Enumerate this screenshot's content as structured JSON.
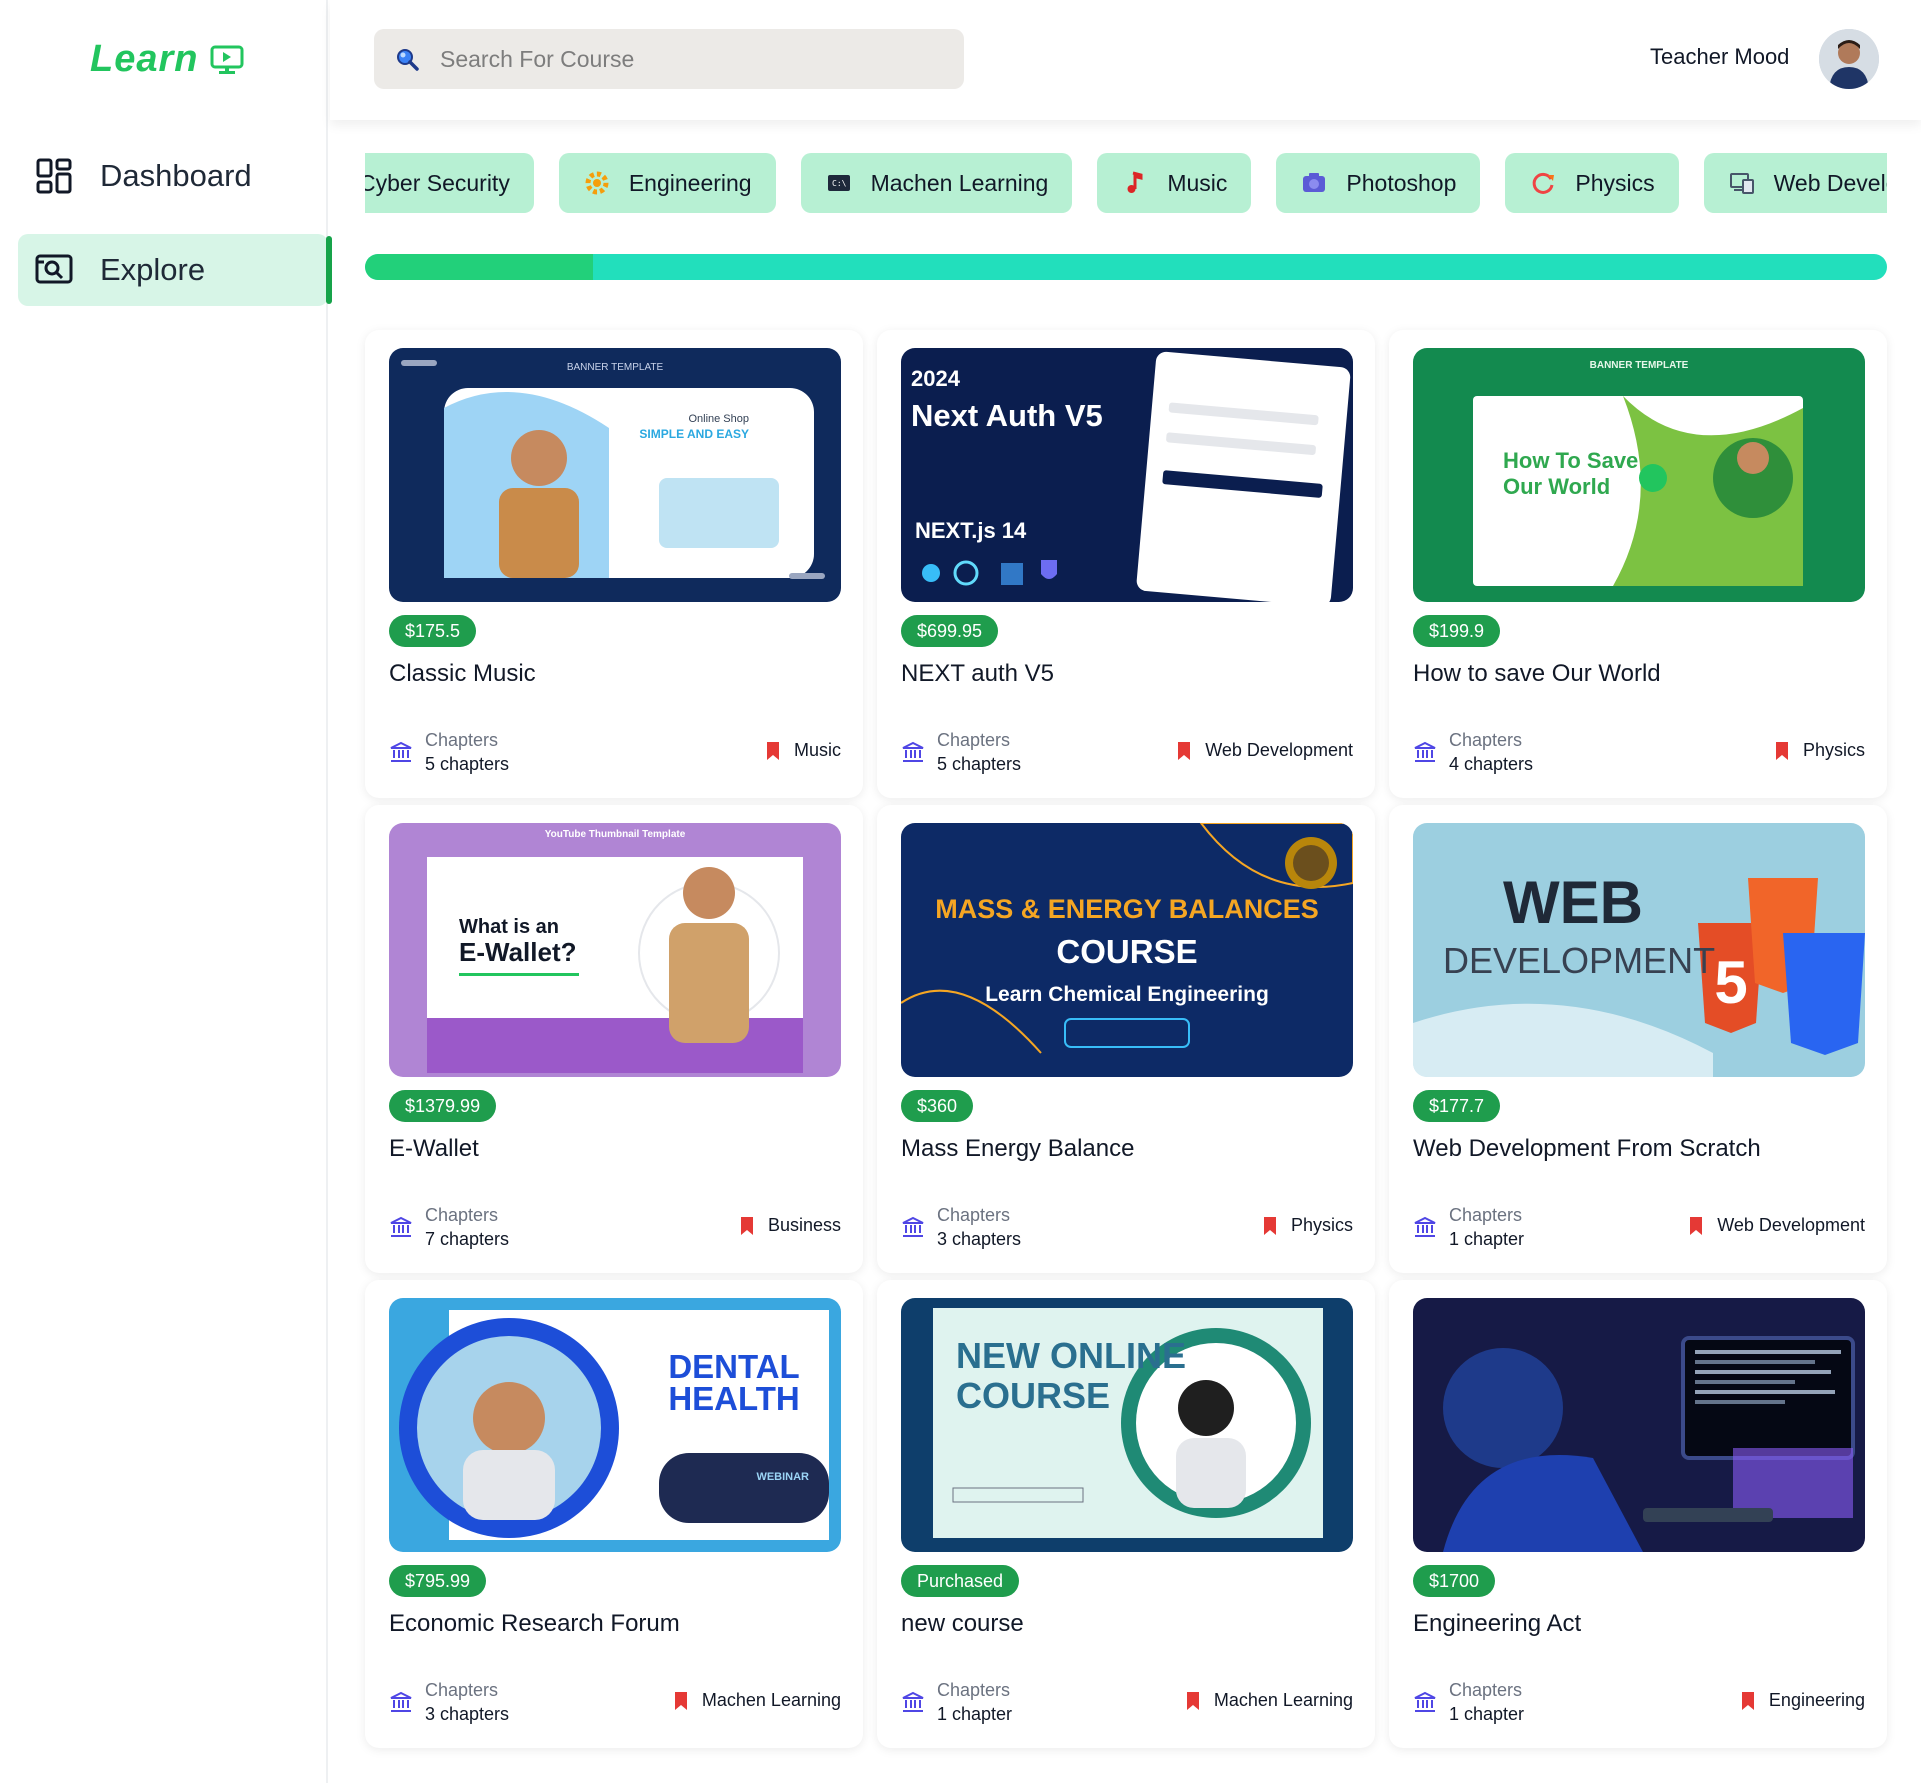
{
  "app": {
    "logo_text": "Learn"
  },
  "sidebar": {
    "items": [
      {
        "label": "Dashboard",
        "icon": "dashboard-icon",
        "active": false
      },
      {
        "label": "Explore",
        "icon": "explore-icon",
        "active": true
      }
    ]
  },
  "header": {
    "search_placeholder": "Search For Course",
    "user_name": "Teacher Mood"
  },
  "categories": [
    {
      "label": "Cyber Security",
      "icon": "none"
    },
    {
      "label": "Engineering",
      "icon": "gear-icon"
    },
    {
      "label": "Machen Learning",
      "icon": "terminal-icon"
    },
    {
      "label": "Music",
      "icon": "music-note-icon"
    },
    {
      "label": "Photoshop",
      "icon": "camera-icon"
    },
    {
      "label": "Physics",
      "icon": "refresh-icon"
    },
    {
      "label": "Web Development",
      "icon": "devices-icon"
    }
  ],
  "scroll_position": 0.15,
  "chapters_label": "Chapters",
  "courses": [
    {
      "price": "$175.5",
      "title": "Classic Music",
      "chapters": "5 chapters",
      "category": "Music",
      "thumb": {
        "bg": "#0f2a5c",
        "accent": "#9ed4f5",
        "l1": "BANNER TEMPLATE",
        "l2": "Online Shop",
        "l3": "SIMPLE AND EASY"
      }
    },
    {
      "price": "$699.95",
      "title": "NEXT auth V5",
      "chapters": "5 chapters",
      "category": "Web Development",
      "thumb": {
        "bg": "#0b1e4f",
        "accent": "#ffffff",
        "l1": "2024",
        "l2": "Next Auth V5",
        "l3": "NEXT.js 14"
      }
    },
    {
      "price": "$199.9",
      "title": "How to save Our World",
      "chapters": "4 chapters",
      "category": "Physics",
      "thumb": {
        "bg": "#138a4f",
        "accent": "#ffffff",
        "l1": "BANNER TEMPLATE",
        "l2": "How To Save",
        "l3": "Our World"
      }
    },
    {
      "price": "$1379.99",
      "title": "E-Wallet",
      "chapters": "7 chapters",
      "category": "Business",
      "thumb": {
        "bg": "#b085d4",
        "accent": "#ffffff",
        "l1": "YouTube Thumbnail Template",
        "l2": "What is an",
        "l3": "E-Wallet?"
      }
    },
    {
      "price": "$360",
      "title": "Mass Energy Balance",
      "chapters": "3 chapters",
      "category": "Physics",
      "thumb": {
        "bg": "#0d2a66",
        "accent": "#f5a623",
        "l1": "MASS & ENERGY BALANCES",
        "l2": "COURSE",
        "l3": "Learn Chemical Engineering"
      }
    },
    {
      "price": "$177.7",
      "title": "Web Development From Scratch",
      "chapters": "1 chapter",
      "category": "Web Development",
      "thumb": {
        "bg": "#9ccfe0",
        "accent": "#e44d26",
        "l1": "WEB",
        "l2": "DEVELOPMENT",
        "l3": ""
      }
    },
    {
      "price": "$795.99",
      "title": "Economic Research Forum",
      "chapters": "3 chapters",
      "category": "Machen Learning",
      "thumb": {
        "bg": "#3aa7e0",
        "accent": "#ffffff",
        "l1": "DENTAL",
        "l2": "HEALTH",
        "l3": "WEBINAR"
      }
    },
    {
      "price": "Purchased",
      "title": "new course",
      "chapters": "1 chapter",
      "category": "Machen Learning",
      "thumb": {
        "bg": "#0e3e6b",
        "accent": "#dff3ef",
        "l1": "NEW ONLINE",
        "l2": "COURSE",
        "l3": ""
      }
    },
    {
      "price": "$1700",
      "title": "Engineering Act",
      "chapters": "1 chapter",
      "category": "Engineering",
      "thumb": {
        "bg": "#161a46",
        "accent": "#3e6fd8",
        "l1": "",
        "l2": "",
        "l3": ""
      }
    }
  ],
  "colors": {
    "accent": "#22c55e",
    "chip_bg": "#b7f0d3",
    "price_bg": "#1f9d4d",
    "bookmark": "#e53935"
  }
}
